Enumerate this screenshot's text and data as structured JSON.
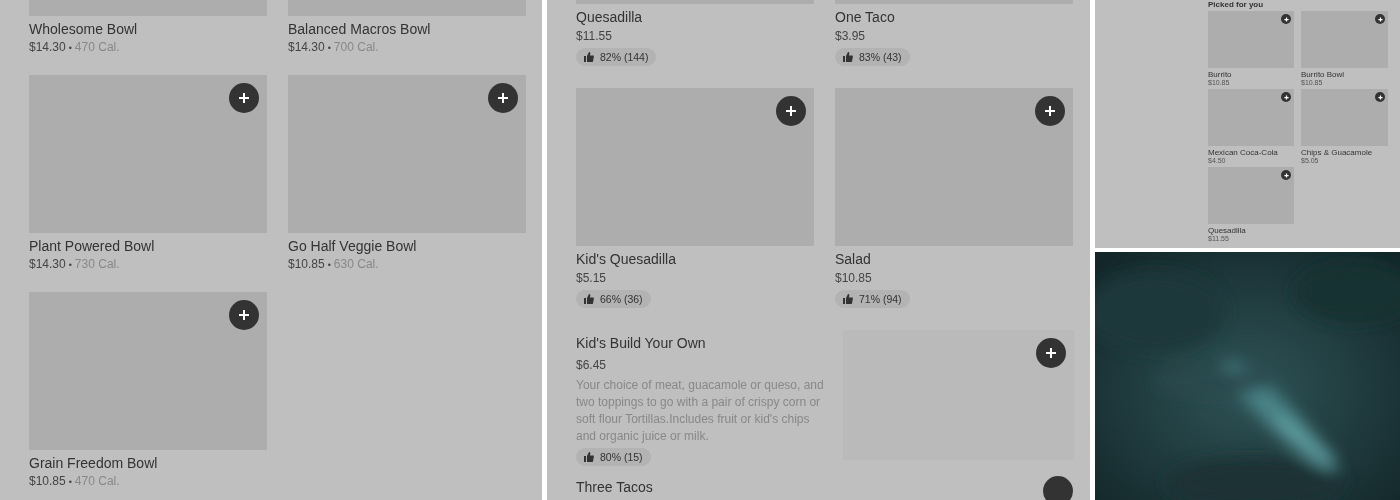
{
  "left_panel": {
    "separator": "•",
    "items": [
      {
        "name": "Wholesome Bowl",
        "price": "$14.30",
        "calories": "470 Cal."
      },
      {
        "name": "Balanced Macros Bowl",
        "price": "$14.30",
        "calories": "700 Cal."
      },
      {
        "name": "Plant Powered Bowl",
        "price": "$14.30",
        "calories": "730 Cal."
      },
      {
        "name": "Go Half Veggie Bowl",
        "price": "$10.85",
        "calories": "630 Cal."
      },
      {
        "name": "Grain Freedom Bowl",
        "price": "$10.85",
        "calories": "470 Cal."
      }
    ]
  },
  "middle_panel": {
    "grid_items": [
      {
        "name": "Quesadilla",
        "price": "$11.55",
        "rating": "82% (144)"
      },
      {
        "name": "One Taco",
        "price": "$3.95",
        "rating": "83% (43)"
      },
      {
        "name": "Kid's Quesadilla",
        "price": "$5.15",
        "rating": "66% (36)"
      },
      {
        "name": "Salad",
        "price": "$10.85",
        "rating": "71% (94)"
      }
    ],
    "featured": {
      "name": "Kid's Build Your Own",
      "price": "$6.45",
      "description": "Your choice of meat, guacamole or queso, and two toppings to go with a pair of crispy corn or soft flour Tortillas.Includes fruit or kid's chips and organic juice or milk.",
      "rating": "80% (15)"
    },
    "next_item": {
      "name": "Three Tacos"
    }
  },
  "right_panel": {
    "section_title": "Picked for you",
    "items": [
      {
        "name": "Burrito",
        "price": "$10.85"
      },
      {
        "name": "Burrito Bowl",
        "price": "$10.85"
      },
      {
        "name": "Mexican Coca-Cola",
        "price": "$4.50"
      },
      {
        "name": "Chips & Guacamole",
        "price": "$5.05"
      },
      {
        "name": "Quesadilla",
        "price": "$11.55"
      }
    ]
  }
}
